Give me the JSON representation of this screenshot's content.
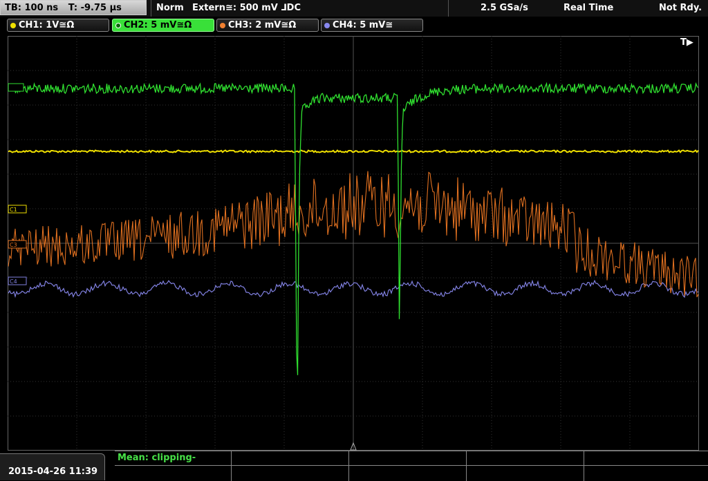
{
  "header": {
    "timebase": "TB: 100 ns",
    "trigger_time": "T: -9.75 µs",
    "mode": "Norm",
    "trigger": "Extern≅: 500 mV ⅃DC",
    "sample_rate": "2.5 GSa/s",
    "acq_mode": "Real Time",
    "status": "Not Rdy."
  },
  "channels": [
    {
      "label": "CH1: 1V≅Ω",
      "color": "#f0e000"
    },
    {
      "label": "CH2: 5 mV≅Ω",
      "color": "#39e039",
      "active": true
    },
    {
      "label": "CH3: 2 mV≅Ω",
      "color": "#f08030"
    },
    {
      "label": "CH4: 5 mV≅",
      "color": "#8888ee"
    }
  ],
  "markers": {
    "c1": "C1",
    "c3": "C3",
    "c4": "C4",
    "trigger_flag": "T▶"
  },
  "footer": {
    "datetime": "2015-04-26 11:39",
    "measurement": "Mean: clipping-"
  }
}
